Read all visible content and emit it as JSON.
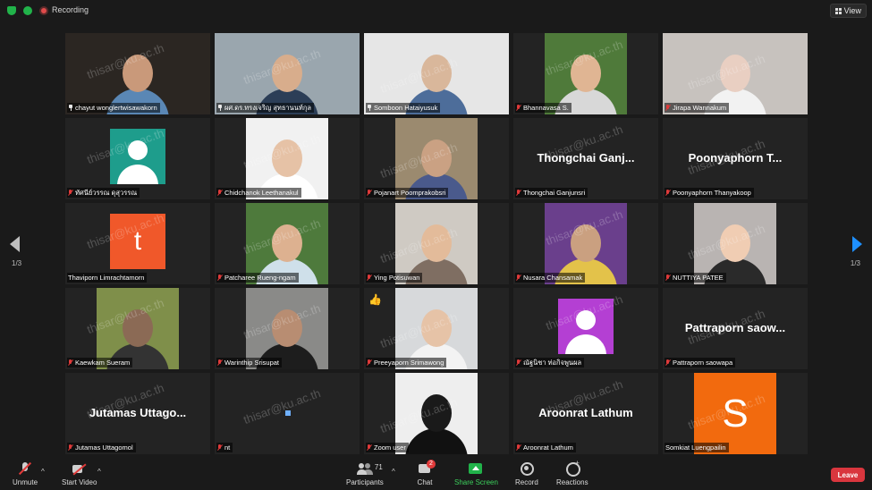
{
  "topbar": {
    "recording_label": "Recording",
    "view_label": "View"
  },
  "navigation": {
    "page_left": "1/3",
    "page_right": "1/3"
  },
  "watermark": "thisar@ku.ac.th",
  "participants": [
    {
      "name": "chayut wonglertwisawakorn",
      "status": "pinned",
      "kind": "video",
      "video_width": "full",
      "colors": {
        "bg": "#2b2622",
        "head": "#c9997a",
        "body": "#5a87b5"
      }
    },
    {
      "name": "ผศ.ดร.ทรงเจริญ สุทธานนท์กุล",
      "status": "pinned",
      "kind": "video",
      "video_width": "full",
      "speaking": true,
      "colors": {
        "bg": "#9aa6ae",
        "head": "#d8ad8c",
        "body": "#2c3e57"
      }
    },
    {
      "name": "Somboon Hataiyusuk",
      "status": "pinned",
      "kind": "video",
      "video_width": "full",
      "colors": {
        "bg": "#e6e6e6",
        "head": "#d9b79b",
        "body": "#4d6d9a"
      }
    },
    {
      "name": "Bhannavasa S.",
      "status": "muted",
      "kind": "video",
      "video_width": "narrow",
      "colors": {
        "bg": "#4f7a3a",
        "head": "#e0b593",
        "body": "#d8d8d8"
      }
    },
    {
      "name": "Jirapa Wannakum",
      "status": "muted",
      "kind": "video",
      "video_width": "full",
      "colors": {
        "bg": "#c7c2be",
        "head": "#e9cfc2",
        "body": "#f2f2f2"
      }
    },
    {
      "name": "ทัศนีย์วรรณ ดุสุวรรณ",
      "status": "muted",
      "kind": "avatar",
      "avatar_color": "#1e9d8c"
    },
    {
      "name": "Chidchanok Leethanakul",
      "status": "muted",
      "kind": "video",
      "video_width": "narrow",
      "colors": {
        "bg": "#f1f1f1",
        "head": "#e6c2a6",
        "body": "#ffffff"
      }
    },
    {
      "name": "Pojanart Poomprakobsri",
      "status": "muted",
      "kind": "video",
      "video_width": "narrow",
      "colors": {
        "bg": "#9b8a6f",
        "head": "#caa183",
        "body": "#4a5a8c"
      }
    },
    {
      "name": "Thongchai Ganjunsri",
      "status": "muted",
      "kind": "name",
      "big_name": "Thongchai  Ganj..."
    },
    {
      "name": "Poonyaphorn Thanyakoop",
      "status": "muted",
      "kind": "name",
      "big_name": "Poonyaphorn  T..."
    },
    {
      "name": "Thaviporn Limrachtamorn",
      "status": "none",
      "kind": "letter",
      "avatar_color": "#f0582a",
      "letter": "t"
    },
    {
      "name": "Patcharee Rueng-ngam",
      "status": "muted",
      "kind": "video",
      "video_width": "narrow",
      "colors": {
        "bg": "#4e7a3c",
        "head": "#ddb190",
        "body": "#cfe0ea"
      }
    },
    {
      "name": "Ying Potisuwan",
      "status": "muted",
      "kind": "video",
      "video_width": "narrow",
      "colors": {
        "bg": "#cfcac3",
        "head": "#e3bb9a",
        "body": "#7f6e62"
      }
    },
    {
      "name": "Nusara Chansamak",
      "status": "muted",
      "kind": "video",
      "video_width": "narrow",
      "colors": {
        "bg": "#6a3f8c",
        "head": "#caa080",
        "body": "#e3c24a"
      }
    },
    {
      "name": "NUTTIYA PATEE",
      "status": "muted",
      "kind": "video",
      "video_width": "narrow",
      "colors": {
        "bg": "#b9b4b2",
        "head": "#f0cdb3",
        "body": "#2a2a2a"
      }
    },
    {
      "name": "Kaewkam Sueram",
      "status": "muted",
      "kind": "video",
      "video_width": "narrow",
      "colors": {
        "bg": "#7f8f4a",
        "head": "#8b6a55",
        "body": "#333333"
      }
    },
    {
      "name": "Warinthip Srisupat",
      "status": "muted",
      "kind": "video",
      "video_width": "narrow",
      "colors": {
        "bg": "#8a8a88",
        "head": "#b88d72",
        "body": "#1d1d1d"
      }
    },
    {
      "name": "Preeyaporn Srimawong",
      "status": "muted",
      "kind": "video",
      "video_width": "narrow",
      "thumbs": "👍",
      "colors": {
        "bg": "#d7d9db",
        "head": "#e6c3a7",
        "body": "#f3f3f3"
      }
    },
    {
      "name": "ณัฐนิชา ท่อกิจพูนผล",
      "status": "muted",
      "kind": "avatar",
      "avatar_color": "#b43fd3"
    },
    {
      "name": "Pattraporn saowapa",
      "status": "muted",
      "kind": "name",
      "big_name": "Pattraporn  saow..."
    },
    {
      "name": "Jutamas Uttagomol",
      "status": "muted",
      "kind": "name",
      "big_name": "Jutamas  Uttago..."
    },
    {
      "name": "nt",
      "status": "muted",
      "kind": "blank"
    },
    {
      "name": "Zoom user",
      "status": "muted",
      "kind": "video",
      "video_width": "narrow",
      "colors": {
        "bg": "#eeeeee",
        "head": "#1a1a1a",
        "body": "#111111"
      }
    },
    {
      "name": "Aroonrat Lathum",
      "status": "muted",
      "kind": "name",
      "big_name": "Aroonrat  Lathum"
    },
    {
      "name": "Somkiat Luengpailin",
      "status": "none",
      "kind": "letter",
      "avatar_color": "#f26a0e",
      "letter": "S",
      "large": true
    }
  ],
  "toolbar": {
    "unmute": "Unmute",
    "start_video": "Start Video",
    "participants": "Participants",
    "participants_count": "71",
    "chat": "Chat",
    "chat_badge": "2",
    "share_screen": "Share Screen",
    "record": "Record",
    "reactions": "Reactions",
    "leave": "Leave"
  },
  "colors": {
    "accent_green": "#21b34a",
    "leave_red": "#d9363e",
    "speaker_outline": "#d7e03a",
    "next_arrow": "#1e90ff"
  }
}
